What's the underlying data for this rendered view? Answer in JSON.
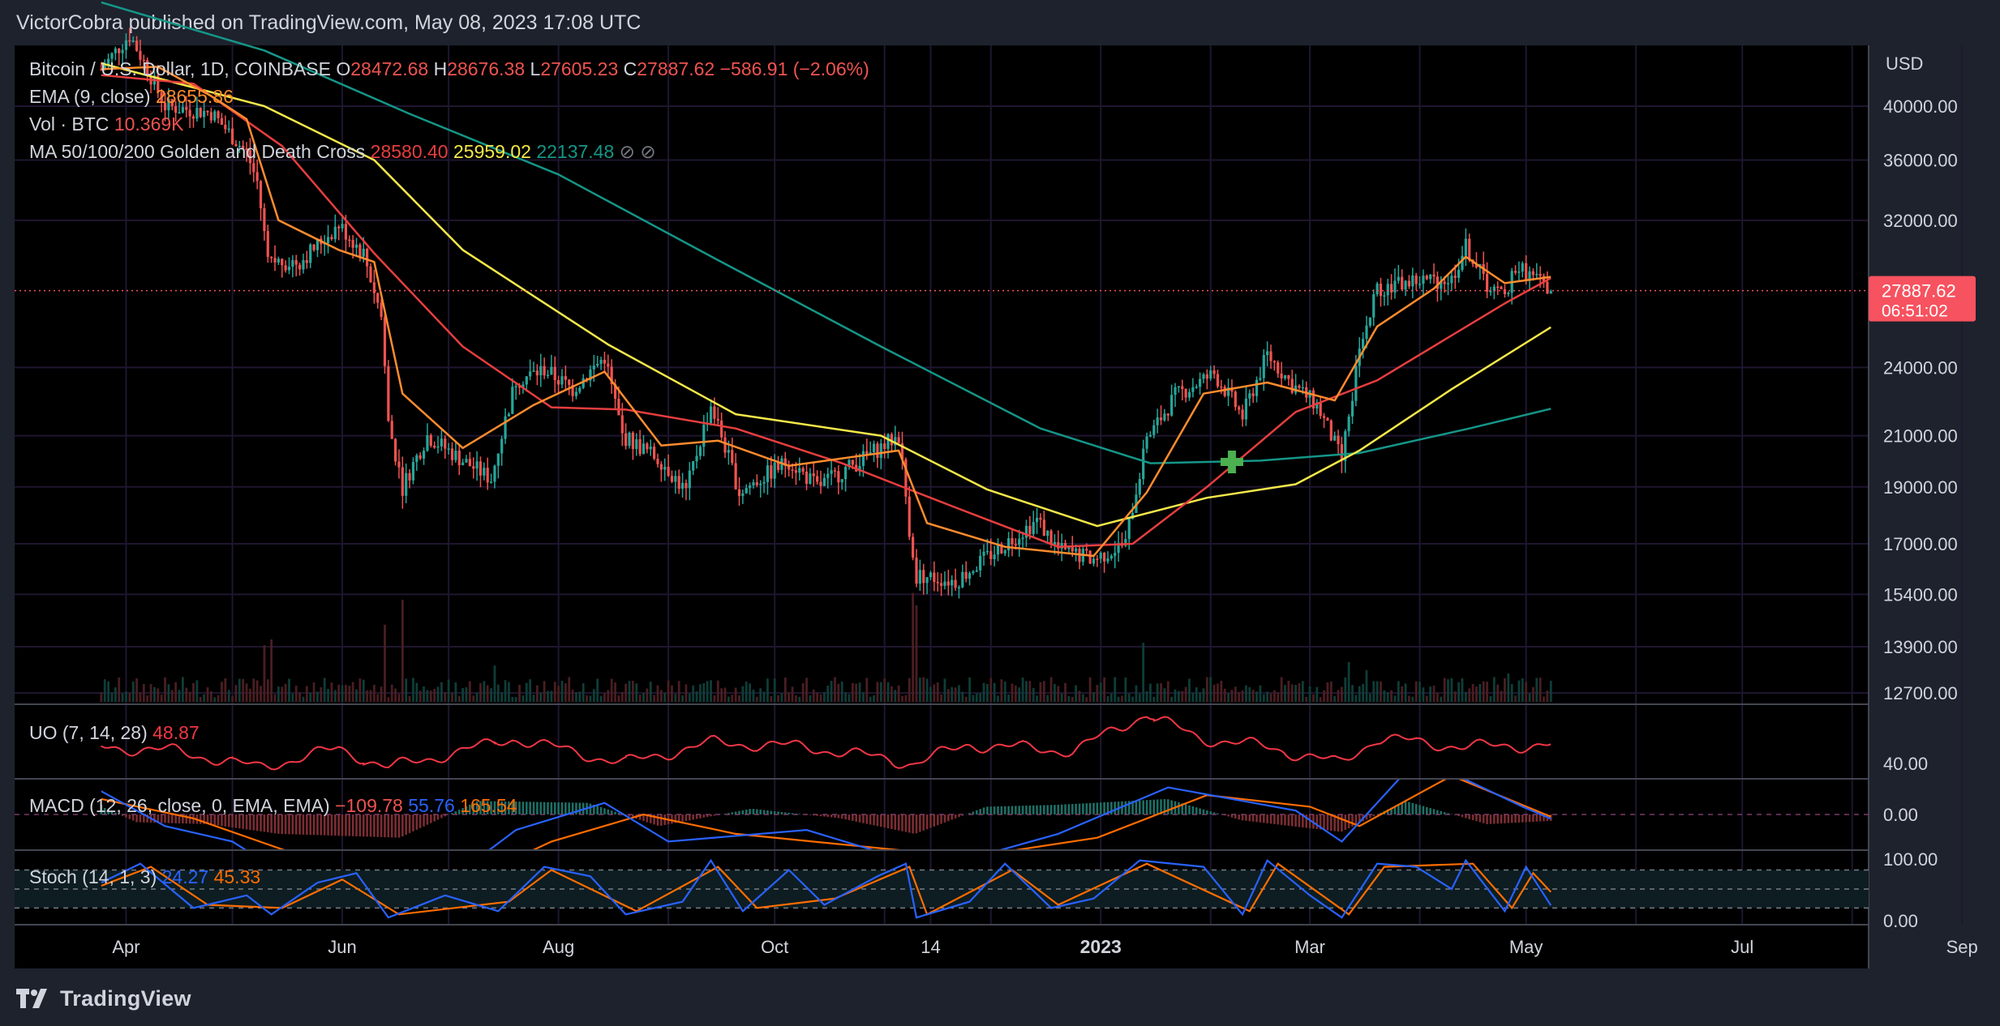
{
  "header": {
    "publisher": "VictorCobra published on TradingView.com, May 08, 2023 17:08 UTC"
  },
  "footer": {
    "brand": "TradingView"
  },
  "colors": {
    "background": "#000000",
    "frame": "#1e222d",
    "grid": "#1f1630",
    "text": "#d1d4dc",
    "up": "#26a69a",
    "down": "#ef5350",
    "ema": "#ff8c2e",
    "ma50": "#e63e3e",
    "ma100": "#f5e84a",
    "ma200": "#159688",
    "price_line": "#f7525f",
    "golden_cross": "#4caf50",
    "uo": "#f23645",
    "macd": "#2962ff",
    "signal": "#ff6d00",
    "stoch_k": "#2962ff",
    "stoch_d": "#ff6d00"
  },
  "chart_data": {
    "type": "candlestick",
    "symbol_line": {
      "name": "Bitcoin / U.S. Dollar, 1D, COINBASE",
      "open_label": "O",
      "open": "28472.68",
      "high_label": "H",
      "high": "28676.38",
      "low_label": "L",
      "low": "27605.23",
      "close_label": "C",
      "close": "27887.62",
      "change": "−586.91 (−2.06%)"
    },
    "indicators": [
      {
        "name": "EMA (9, close)",
        "values": [
          "28655.86"
        ]
      },
      {
        "name": "Vol · BTC",
        "values": [
          "10.369K"
        ]
      },
      {
        "name": "MA 50/100/200 Golden and Death Cross",
        "values": [
          "28580.40",
          "25959.02",
          "22137.48"
        ]
      }
    ],
    "y_axis": {
      "unit": "USD",
      "scale": "log",
      "ticks": [
        "40000.00",
        "36000.00",
        "32000.00",
        "24000.00",
        "21000.00",
        "19000.00",
        "17000.00",
        "15400.00",
        "13900.00",
        "12700.00"
      ]
    },
    "x_axis": {
      "ticks": [
        "Apr",
        "Jun",
        "Aug",
        "Oct",
        "14",
        "2023",
        "Mar",
        "May",
        "Jul",
        "Sep"
      ]
    },
    "price_label": {
      "price": "27887.62",
      "countdown": "06:51:02"
    },
    "price_path": [
      [
        "2022-03-25",
        43000
      ],
      [
        "2022-04-02",
        46000
      ],
      [
        "2022-04-12",
        40000
      ],
      [
        "2022-04-25",
        39500
      ],
      [
        "2022-05-05",
        36500
      ],
      [
        "2022-05-08",
        34500
      ],
      [
        "2022-05-11",
        29500
      ],
      [
        "2022-05-20",
        29500
      ],
      [
        "2022-05-31",
        31700
      ],
      [
        "2022-06-07",
        30000
      ],
      [
        "2022-06-12",
        26500
      ],
      [
        "2022-06-14",
        21500
      ],
      [
        "2022-06-18",
        19000
      ],
      [
        "2022-06-25",
        21000
      ],
      [
        "2022-07-05",
        20000
      ],
      [
        "2022-07-13",
        19300
      ],
      [
        "2022-07-20",
        23400
      ],
      [
        "2022-07-28",
        23900
      ],
      [
        "2022-08-05",
        23000
      ],
      [
        "2022-08-14",
        24500
      ],
      [
        "2022-08-19",
        21000
      ],
      [
        "2022-08-30",
        20000
      ],
      [
        "2022-09-06",
        18800
      ],
      [
        "2022-09-13",
        22300
      ],
      [
        "2022-09-21",
        18800
      ],
      [
        "2022-10-05",
        20000
      ],
      [
        "2022-10-13",
        19000
      ],
      [
        "2022-10-25",
        20000
      ],
      [
        "2022-11-05",
        21000
      ],
      [
        "2022-11-08",
        17500
      ],
      [
        "2022-11-10",
        16000
      ],
      [
        "2022-11-21",
        15800
      ],
      [
        "2022-12-05",
        17000
      ],
      [
        "2022-12-14",
        17800
      ],
      [
        "2022-12-20",
        16800
      ],
      [
        "2022-12-30",
        16500
      ],
      [
        "2023-01-08",
        17000
      ],
      [
        "2023-01-14",
        20800
      ],
      [
        "2023-01-22",
        22700
      ],
      [
        "2023-02-02",
        23700
      ],
      [
        "2023-02-10",
        21800
      ],
      [
        "2023-02-17",
        24600
      ],
      [
        "2023-02-24",
        23200
      ],
      [
        "2023-03-03",
        22300
      ],
      [
        "2023-03-10",
        20000
      ],
      [
        "2023-03-15",
        24700
      ],
      [
        "2023-03-20",
        28000
      ],
      [
        "2023-03-30",
        28400
      ],
      [
        "2023-04-10",
        28500
      ],
      [
        "2023-04-14",
        30400
      ],
      [
        "2023-04-20",
        28200
      ],
      [
        "2023-04-25",
        27500
      ],
      [
        "2023-04-28",
        29300
      ],
      [
        "2023-05-08",
        27887
      ]
    ],
    "ema9": [
      [
        "2022-03-25",
        43000
      ],
      [
        "2022-04-10",
        43200
      ],
      [
        "2022-04-25",
        40800
      ],
      [
        "2022-05-05",
        39000
      ],
      [
        "2022-05-14",
        32000
      ],
      [
        "2022-05-31",
        30200
      ],
      [
        "2022-06-10",
        29500
      ],
      [
        "2022-06-18",
        22800
      ],
      [
        "2022-07-05",
        20500
      ],
      [
        "2022-07-25",
        22300
      ],
      [
        "2022-08-14",
        23800
      ],
      [
        "2022-08-30",
        20600
      ],
      [
        "2022-09-15",
        20800
      ],
      [
        "2022-10-05",
        19800
      ],
      [
        "2022-11-05",
        20400
      ],
      [
        "2022-11-13",
        17700
      ],
      [
        "2022-12-05",
        16900
      ],
      [
        "2022-12-30",
        16600
      ],
      [
        "2023-01-14",
        18800
      ],
      [
        "2023-01-30",
        22800
      ],
      [
        "2023-02-17",
        23300
      ],
      [
        "2023-03-08",
        22500
      ],
      [
        "2023-03-20",
        26000
      ],
      [
        "2023-04-05",
        28000
      ],
      [
        "2023-04-14",
        29800
      ],
      [
        "2023-04-25",
        28300
      ],
      [
        "2023-05-08",
        28650
      ]
    ],
    "ma50": [
      [
        "2022-03-25",
        42500
      ],
      [
        "2022-04-20",
        41800
      ],
      [
        "2022-05-15",
        37000
      ],
      [
        "2022-06-10",
        30000
      ],
      [
        "2022-07-05",
        25000
      ],
      [
        "2022-07-30",
        22200
      ],
      [
        "2022-08-20",
        22100
      ],
      [
        "2022-09-20",
        21300
      ],
      [
        "2022-10-20",
        19900
      ],
      [
        "2022-11-20",
        18300
      ],
      [
        "2022-12-20",
        16900
      ],
      [
        "2023-01-10",
        17000
      ],
      [
        "2023-01-31",
        19000
      ],
      [
        "2023-02-25",
        22000
      ],
      [
        "2023-03-20",
        23400
      ],
      [
        "2023-04-25",
        27200
      ],
      [
        "2023-05-08",
        28580
      ]
    ],
    "ma100": [
      [
        "2022-03-25",
        43500
      ],
      [
        "2022-05-10",
        40000
      ],
      [
        "2022-06-10",
        36000
      ],
      [
        "2022-07-05",
        30200
      ],
      [
        "2022-08-15",
        25100
      ],
      [
        "2022-09-20",
        21900
      ],
      [
        "2022-10-31",
        21000
      ],
      [
        "2022-11-30",
        18900
      ],
      [
        "2022-12-31",
        17600
      ],
      [
        "2023-01-31",
        18600
      ],
      [
        "2023-02-25",
        19100
      ],
      [
        "2023-03-15",
        20400
      ],
      [
        "2023-04-10",
        23000
      ],
      [
        "2023-05-08",
        25959
      ]
    ],
    "ma200": [
      [
        "2022-03-25",
        49000
      ],
      [
        "2022-05-10",
        44600
      ],
      [
        "2022-06-20",
        39400
      ],
      [
        "2022-08-01",
        35000
      ],
      [
        "2022-09-15",
        29600
      ],
      [
        "2022-10-31",
        25000
      ],
      [
        "2022-12-15",
        21300
      ],
      [
        "2023-01-15",
        19900
      ],
      [
        "2023-02-15",
        20000
      ],
      [
        "2023-03-15",
        20300
      ],
      [
        "2023-04-15",
        21300
      ],
      [
        "2023-05-08",
        22137
      ]
    ],
    "golden_cross": {
      "date": "2023-02-07",
      "price": 19950
    },
    "volume_spikes": [
      [
        "2022-05-10",
        0.5
      ],
      [
        "2022-05-12",
        0.55
      ],
      [
        "2022-06-13",
        0.68
      ],
      [
        "2022-06-18",
        0.9
      ],
      [
        "2022-07-14",
        0.32
      ],
      [
        "2022-11-09",
        0.96
      ],
      [
        "2022-11-10",
        0.85
      ],
      [
        "2023-01-13",
        0.52
      ],
      [
        "2023-03-12",
        0.35
      ],
      [
        "2023-03-17",
        0.28
      ],
      [
        "2023-04-26",
        0.25
      ]
    ],
    "panels": {
      "uo": {
        "name": "UO (7, 14, 28)",
        "value": "48.87",
        "ticks": [
          "40.00"
        ],
        "points": [
          [
            "2022-03-25",
            48
          ],
          [
            "2022-04-15",
            46
          ],
          [
            "2022-05-09",
            38
          ],
          [
            "2022-05-31",
            47
          ],
          [
            "2022-06-15",
            38
          ],
          [
            "2022-07-20",
            52
          ],
          [
            "2022-08-20",
            40
          ],
          [
            "2022-09-14",
            50
          ],
          [
            "2022-10-10",
            48
          ],
          [
            "2022-11-10",
            40
          ],
          [
            "2022-11-25",
            49
          ],
          [
            "2022-12-25",
            46
          ],
          [
            "2023-01-14",
            64
          ],
          [
            "2023-01-30",
            52
          ],
          [
            "2023-02-17",
            48
          ],
          [
            "2023-03-10",
            40
          ],
          [
            "2023-03-20",
            52
          ],
          [
            "2023-04-15",
            48
          ],
          [
            "2023-05-08",
            48.87
          ]
        ]
      },
      "macd": {
        "name": "MACD (12, 26, close, 0, EMA, EMA)",
        "values": [
          "−109.78",
          "55.76",
          "165.54"
        ],
        "ticks": [
          "0.00"
        ],
        "macd_points": [
          [
            "2022-03-25",
            600
          ],
          [
            "2022-04-12",
            -300
          ],
          [
            "2022-05-01",
            -700
          ],
          [
            "2022-05-20",
            -1800
          ],
          [
            "2022-06-18",
            -2600
          ],
          [
            "2022-07-20",
            -400
          ],
          [
            "2022-08-14",
            300
          ],
          [
            "2022-09-01",
            -700
          ],
          [
            "2022-10-10",
            -400
          ],
          [
            "2022-11-15",
            -1400
          ],
          [
            "2022-12-20",
            -500
          ],
          [
            "2023-01-20",
            700
          ],
          [
            "2023-02-25",
            100
          ],
          [
            "2023-03-10",
            -700
          ],
          [
            "2023-03-30",
            1300
          ],
          [
            "2023-04-14",
            900
          ],
          [
            "2023-04-30",
            200
          ],
          [
            "2023-05-08",
            -109.78
          ]
        ],
        "signal_points": [
          [
            "2022-03-25",
            400
          ],
          [
            "2022-04-20",
            -100
          ],
          [
            "2022-05-15",
            -900
          ],
          [
            "2022-06-25",
            -2200
          ],
          [
            "2022-07-30",
            -700
          ],
          [
            "2022-08-25",
            0
          ],
          [
            "2022-09-20",
            -500
          ],
          [
            "2022-11-25",
            -1100
          ],
          [
            "2022-12-31",
            -600
          ],
          [
            "2023-01-31",
            500
          ],
          [
            "2023-03-01",
            200
          ],
          [
            "2023-03-15",
            -300
          ],
          [
            "2023-04-10",
            1000
          ],
          [
            "2023-05-08",
            -55.76
          ]
        ],
        "hist_points": [
          [
            "2022-03-25",
            250
          ],
          [
            "2022-04-05",
            -200
          ],
          [
            "2022-04-25",
            -250
          ],
          [
            "2022-05-15",
            -500
          ],
          [
            "2022-06-18",
            -600
          ],
          [
            "2022-07-10",
            350
          ],
          [
            "2022-08-10",
            300
          ],
          [
            "2022-08-30",
            -300
          ],
          [
            "2022-09-25",
            150
          ],
          [
            "2022-10-20",
            -100
          ],
          [
            "2022-11-10",
            -500
          ],
          [
            "2022-11-30",
            200
          ],
          [
            "2022-12-20",
            250
          ],
          [
            "2023-01-20",
            400
          ],
          [
            "2023-02-10",
            -150
          ],
          [
            "2023-03-10",
            -450
          ],
          [
            "2023-03-28",
            350
          ],
          [
            "2023-04-20",
            -250
          ],
          [
            "2023-05-08",
            -165.54
          ]
        ]
      },
      "stoch": {
        "name": "Stoch (14, 1, 3)",
        "values": [
          "24.27",
          "45.33"
        ],
        "ticks": [
          "100.00",
          "0.00"
        ],
        "bands": [
          80,
          50,
          20
        ],
        "k_points": [
          [
            "2022-03-25",
            60
          ],
          [
            "2022-04-05",
            90
          ],
          [
            "2022-04-20",
            20
          ],
          [
            "2022-05-05",
            40
          ],
          [
            "2022-05-12",
            10
          ],
          [
            "2022-05-25",
            60
          ],
          [
            "2022-06-05",
            75
          ],
          [
            "2022-06-14",
            5
          ],
          [
            "2022-06-30",
            40
          ],
          [
            "2022-07-15",
            15
          ],
          [
            "2022-07-28",
            85
          ],
          [
            "2022-08-10",
            70
          ],
          [
            "2022-08-20",
            10
          ],
          [
            "2022-09-05",
            30
          ],
          [
            "2022-09-13",
            95
          ],
          [
            "2022-09-22",
            15
          ],
          [
            "2022-10-05",
            80
          ],
          [
            "2022-10-15",
            25
          ],
          [
            "2022-10-30",
            70
          ],
          [
            "2022-11-07",
            90
          ],
          [
            "2022-11-10",
            5
          ],
          [
            "2022-11-25",
            30
          ],
          [
            "2022-12-05",
            90
          ],
          [
            "2022-12-18",
            20
          ],
          [
            "2022-12-30",
            35
          ],
          [
            "2023-01-12",
            95
          ],
          [
            "2023-01-30",
            85
          ],
          [
            "2023-02-10",
            10
          ],
          [
            "2023-02-17",
            95
          ],
          [
            "2023-03-01",
            40
          ],
          [
            "2023-03-10",
            5
          ],
          [
            "2023-03-20",
            90
          ],
          [
            "2023-03-31",
            85
          ],
          [
            "2023-04-10",
            50
          ],
          [
            "2023-04-14",
            95
          ],
          [
            "2023-04-25",
            15
          ],
          [
            "2023-05-01",
            85
          ],
          [
            "2023-05-08",
            24.27
          ]
        ],
        "d_points": [
          [
            "2022-03-25",
            55
          ],
          [
            "2022-04-08",
            85
          ],
          [
            "2022-04-24",
            25
          ],
          [
            "2022-05-15",
            20
          ],
          [
            "2022-06-01",
            65
          ],
          [
            "2022-06-17",
            10
          ],
          [
            "2022-07-18",
            30
          ],
          [
            "2022-07-30",
            80
          ],
          [
            "2022-08-23",
            15
          ],
          [
            "2022-09-15",
            85
          ],
          [
            "2022-09-26",
            20
          ],
          [
            "2022-10-18",
            35
          ],
          [
            "2022-11-08",
            85
          ],
          [
            "2022-11-13",
            10
          ],
          [
            "2022-12-07",
            80
          ],
          [
            "2022-12-20",
            25
          ],
          [
            "2023-01-14",
            90
          ],
          [
            "2023-02-12",
            15
          ],
          [
            "2023-02-20",
            90
          ],
          [
            "2023-03-12",
            10
          ],
          [
            "2023-03-22",
            85
          ],
          [
            "2023-04-16",
            90
          ],
          [
            "2023-04-27",
            20
          ],
          [
            "2023-05-03",
            75
          ],
          [
            "2023-05-08",
            45.33
          ]
        ]
      }
    }
  }
}
